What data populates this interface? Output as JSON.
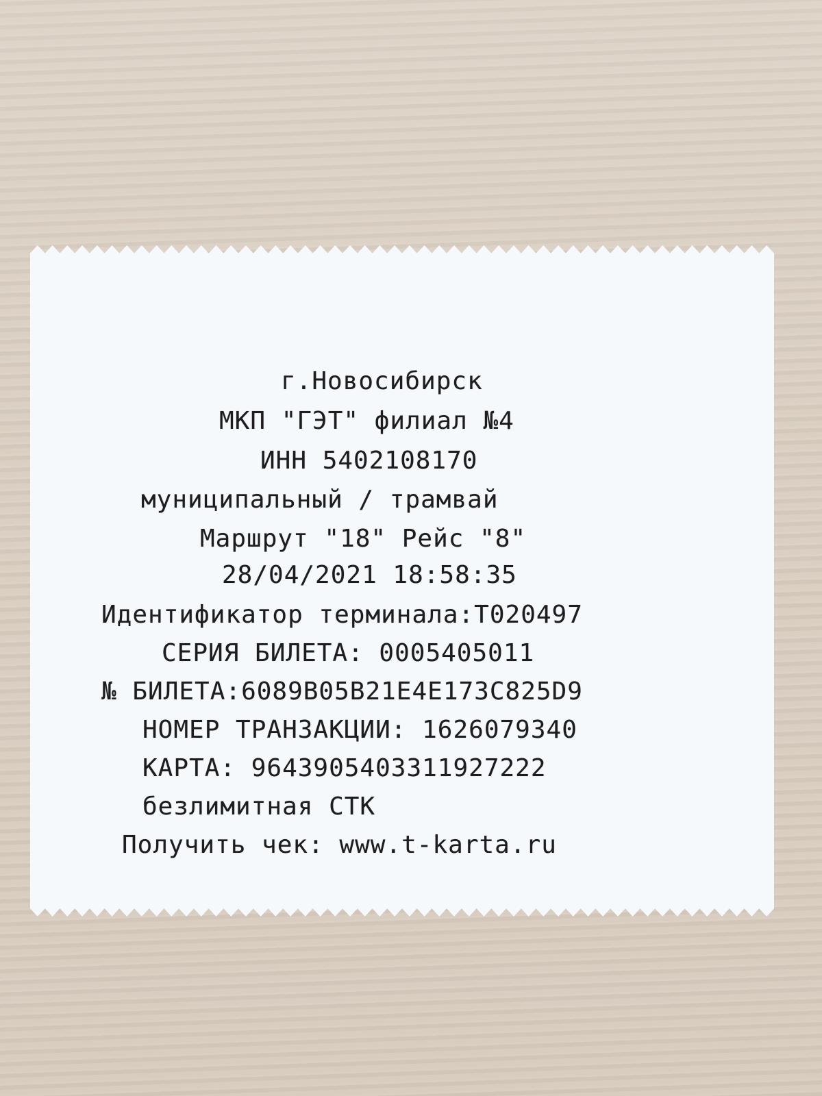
{
  "receipt": {
    "city": "г.Новосибирск",
    "company": "МКП \"ГЭТ\" филиал №4",
    "inn": "ИНН 5402108170",
    "transport": "муниципальный / трамвай",
    "route": "Маршрут \"18\" Рейс \"8\"",
    "datetime": "28/04/2021 18:58:35",
    "terminal": "Идентификатор терминала:Т020497",
    "ticket_series": "СЕРИЯ БИЛЕТА: 0005405011",
    "ticket_number": "№ БИЛЕТА:6089B05B21E4E173C825D9",
    "transaction": "НОМЕР ТРАНЗАКЦИИ: 1626079340",
    "card": "КАРТА: 9643905403311927222",
    "card_type": "безлимитная СТК",
    "get_receipt": "Получить чек: www.t-karta.ru"
  }
}
